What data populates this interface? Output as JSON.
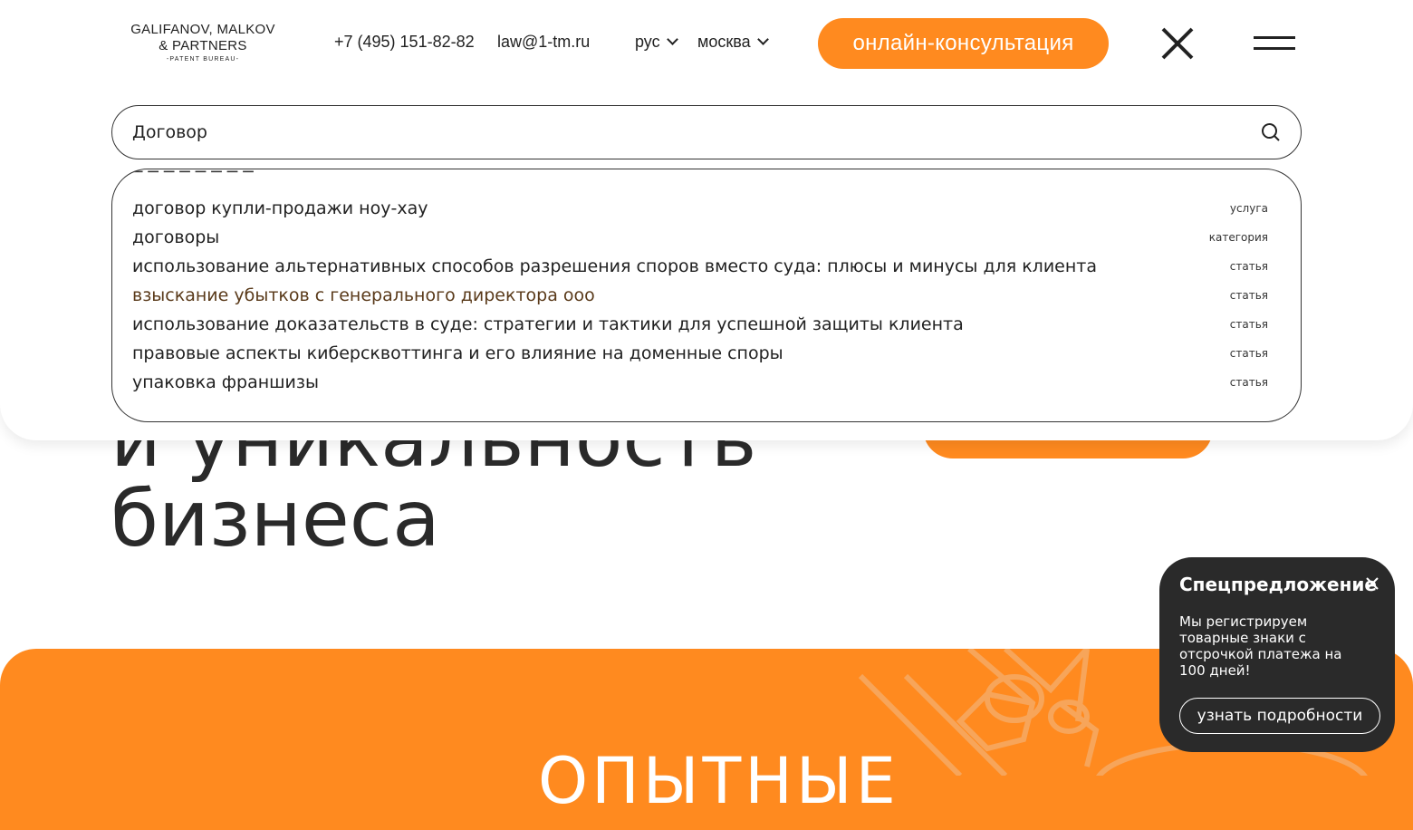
{
  "header": {
    "logo": {
      "line1": "GALIFANOV, MALKOV",
      "line2": "& PARTNERS",
      "line3": "-PATENT BUREAU-"
    },
    "phone": "+7 (495) 151-82-82",
    "email": "law@1-tm.ru",
    "language": "рус",
    "city": "москва",
    "consult_button": "онлайн-консультация",
    "close_icon": "close-icon",
    "menu_icon": "menu-icon"
  },
  "search": {
    "value": "Договор",
    "icon": "search-icon",
    "results": [
      {
        "label": "договор купли-продажи ноу-хау",
        "type": "услуга"
      },
      {
        "label": "договоры",
        "type": "категория"
      },
      {
        "label": "использование альтернативных способов разрешения споров вместо суда: плюсы и минусы для клиента",
        "type": "статья"
      },
      {
        "label": "взыскание убытков с генерального директора ооо",
        "type": "статья"
      },
      {
        "label": "использование доказательств в суде: стратегии и тактики для успешной защиты клиента",
        "type": "статья"
      },
      {
        "label": "правовые аспекты киберсквоттинга и его влияние на доменные споры",
        "type": "статья"
      },
      {
        "label": "упаковка франшизы",
        "type": "статья"
      }
    ]
  },
  "hero": {
    "line1": "и уникальность",
    "line2": "бизнеса"
  },
  "section": {
    "title": "ОПЫТНЫЕ"
  },
  "promo": {
    "title": "Спецпредложение",
    "text": "Мы регистрируем товарные знаки с отсрочкой платежа на 100 дней!",
    "button": "узнать подробности"
  },
  "colors": {
    "accent": "#ff8a1f",
    "dark": "#2a2a2a",
    "active_result": "#5a3a1a"
  }
}
